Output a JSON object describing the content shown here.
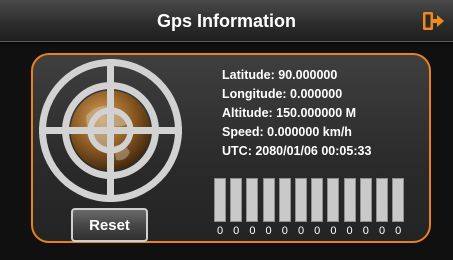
{
  "header": {
    "title": "Gps Information",
    "exit_icon": "exit-icon"
  },
  "info": {
    "latitude": "Latitude: 90.000000",
    "longitude": "Longitude: 0.000000",
    "altitude": "Altitude: 150.000000 M",
    "speed": "Speed: 0.000000 km/h",
    "utc": "UTC: 2080/01/06 00:05:33"
  },
  "reset_label": "Reset",
  "satellites": {
    "labels": [
      "0",
      "0",
      "0",
      "0",
      "0",
      "0",
      "0",
      "0",
      "0",
      "0",
      "0",
      "0"
    ]
  },
  "colors": {
    "accent": "#e8821e",
    "bar": "#c9c9c9"
  }
}
